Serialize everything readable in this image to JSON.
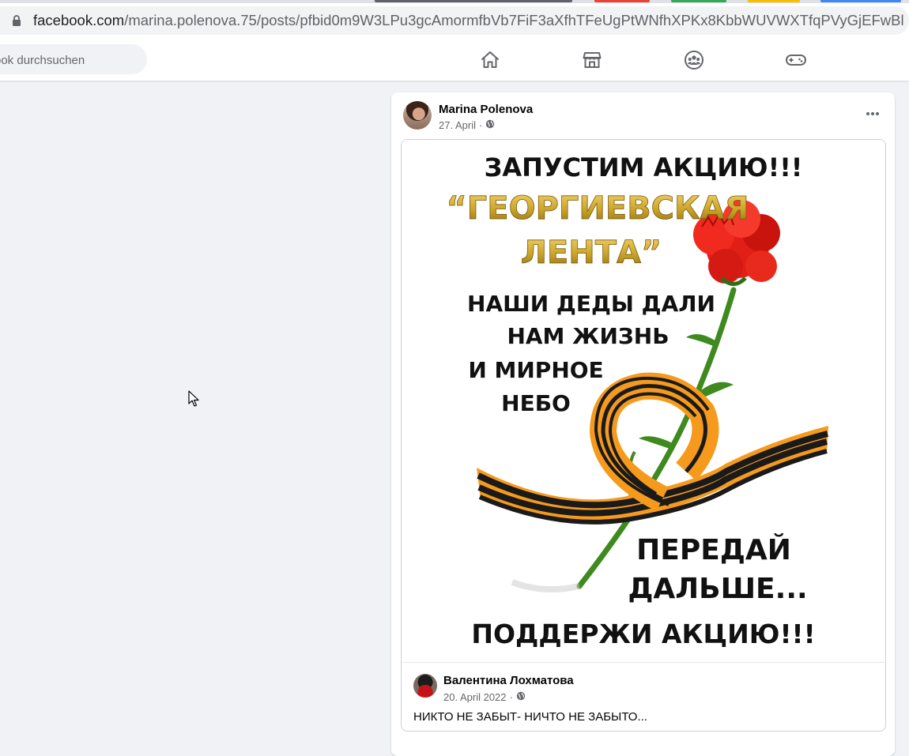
{
  "browser": {
    "url_domain": "facebook.com",
    "url_path": "/marina.polenova.75/posts/pfbid0m9W3LPu3gcAmormfbVb7FiF3aXfhTFeUgPtWNfhXPKx8KbbWUVWXTfqPVyGjEFwBl",
    "tab_colors": [
      "#5f6368",
      "#ea4335",
      "#34a853",
      "#fbbc04",
      "#4285f4"
    ]
  },
  "header": {
    "search_placeholder": "ook durchsuchen",
    "nav_icons": [
      "home-icon",
      "marketplace-icon",
      "groups-icon",
      "gaming-icon"
    ]
  },
  "post": {
    "author": "Marina Polenova",
    "date": "27. April",
    "date_suffix": "·",
    "privacy_icon": "globe-icon",
    "menu_icon": "more-options-icon",
    "shared": {
      "image_text": {
        "line1": "ЗАПУСТИМ АКЦИЮ!!!",
        "line2": "“ГЕОРГИЕВСКАЯ",
        "line3": "ЛЕНТА”",
        "line4": "НАШИ ДЕДЫ ДАЛИ",
        "line5": "НАМ ЖИЗНЬ",
        "line6": "И МИРНОЕ",
        "line7": "НЕБО",
        "line8": "ПЕРЕДАЙ",
        "line9": "ДАЛЬШЕ...",
        "line10": "ПОДДЕРЖИ АКЦИЮ!!!"
      },
      "author": "Валентина Лохматова",
      "date": "20. April 2022",
      "date_suffix": "·",
      "text": "НИКТО НЕ ЗАБЫТ- НИЧТО НЕ ЗАБЫТО..."
    }
  },
  "colors": {
    "page_bg": "#f0f2f5",
    "card_bg": "#ffffff",
    "secondary_text": "#65676b",
    "ribbon_orange": "#f59a1c",
    "ribbon_black": "#1a1a1a",
    "flower_red": "#e21f17",
    "gold_text": "#c9a227"
  }
}
